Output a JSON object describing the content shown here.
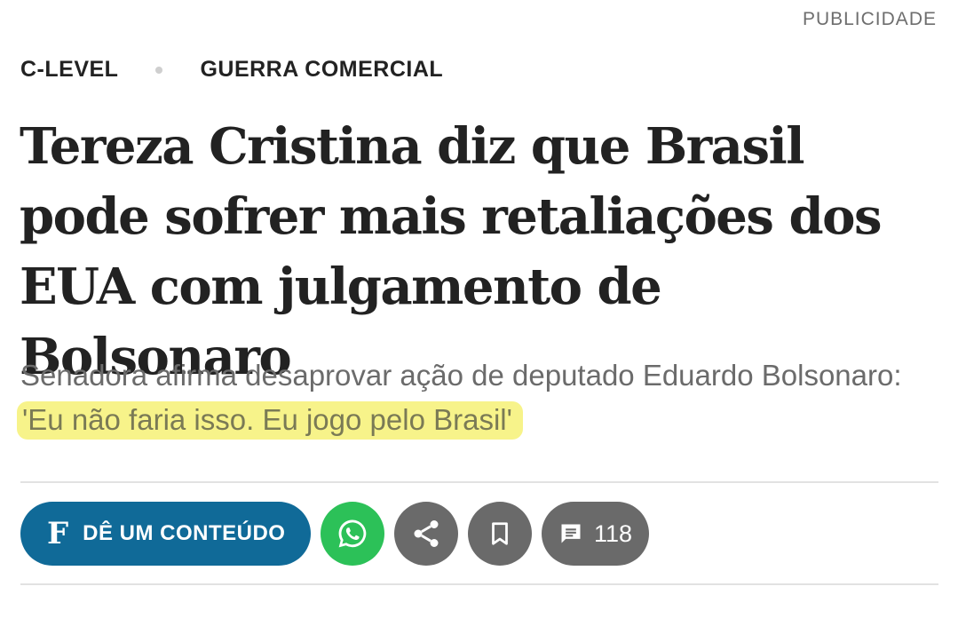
{
  "ad": {
    "label": "PUBLICIDADE"
  },
  "breadcrumb": {
    "section": "C-LEVEL",
    "topic": "GUERRA COMERCIAL"
  },
  "article": {
    "headline": "Tereza Cristina diz que Brasil pode sofrer mais retaliações dos EUA com julgamento de Bolsonaro",
    "subtitle_lead": "Senadora afirma desaprovar ação de deputado Eduardo Bolsonaro:",
    "subtitle_quote": "'Eu não faria isso. Eu jogo pelo Brasil'"
  },
  "actions": {
    "gift": {
      "logo": "F",
      "label": "DÊ UM CONTEÚDO"
    },
    "whatsapp_icon": "whatsapp-icon",
    "share_icon": "share-icon",
    "bookmark_icon": "bookmark-icon",
    "comments": {
      "icon": "comment-icon",
      "count": "118"
    }
  },
  "colors": {
    "gift_button": "#106a98",
    "whatsapp_button": "#2cc158",
    "grey_button": "#6a6a6a",
    "highlight": "#f7f38a",
    "headline_text": "#222222",
    "subtitle_text": "#6b6b6b"
  }
}
